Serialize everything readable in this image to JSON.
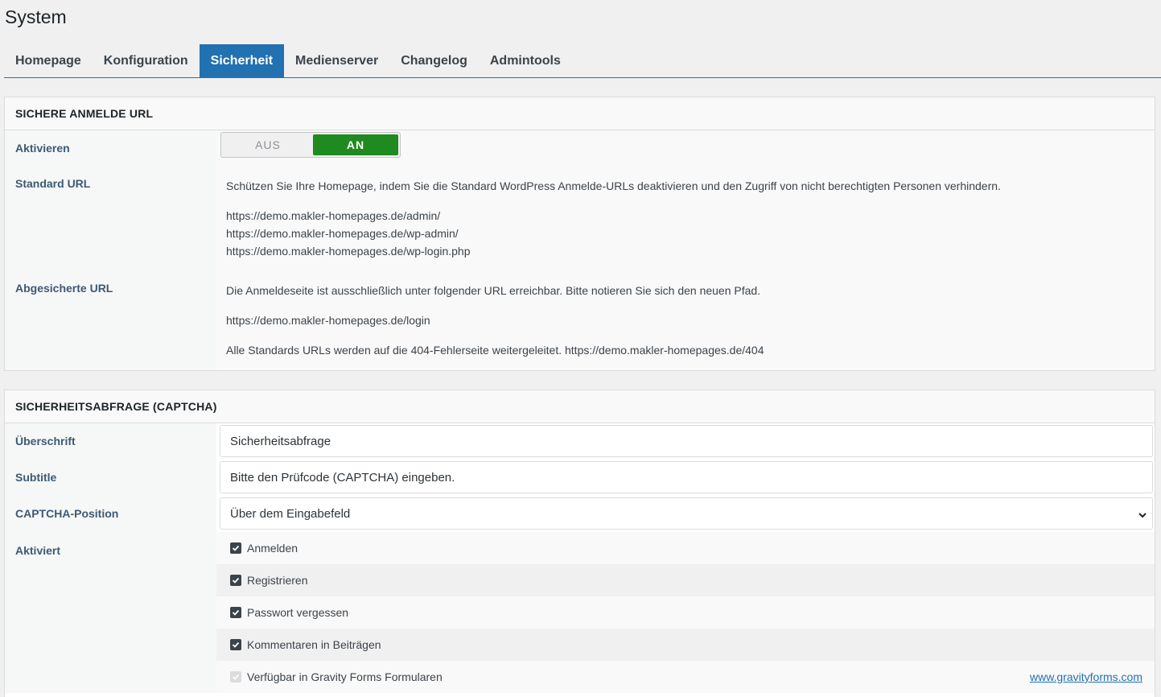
{
  "page": {
    "title": "System"
  },
  "tabs": [
    {
      "label": "Homepage",
      "active": false
    },
    {
      "label": "Konfiguration",
      "active": false
    },
    {
      "label": "Sicherheit",
      "active": true
    },
    {
      "label": "Medienserver",
      "active": false
    },
    {
      "label": "Changelog",
      "active": false
    },
    {
      "label": "Admintools",
      "active": false
    }
  ],
  "secure_login": {
    "header": "SICHERE ANMELDE URL",
    "activate": {
      "label": "Aktivieren",
      "off_label": "AUS",
      "on_label": "AN",
      "state": "on"
    },
    "standard_url": {
      "label": "Standard URL",
      "description": "Schützen Sie Ihre Homepage, indem Sie die Standard WordPress Anmelde-URLs deaktivieren und den Zugriff von nicht berechtigten Personen verhindern.",
      "urls": [
        "https://demo.makler-homepages.de/admin/",
        "https://demo.makler-homepages.de/wp-admin/",
        "https://demo.makler-homepages.de/wp-login.php"
      ]
    },
    "secured_url": {
      "label": "Abgesicherte URL",
      "description": "Die Anmeldeseite ist ausschließlich unter folgender URL erreichbar. Bitte notieren Sie sich den neuen Pfad.",
      "url": "https://demo.makler-homepages.de/login",
      "redirect_note": "Alle Standards URLs werden auf die 404-Fehlerseite weitergeleitet. https://demo.makler-homepages.de/404"
    }
  },
  "captcha": {
    "header": "SICHERHEITSABFRAGE (CAPTCHA)",
    "heading": {
      "label": "Überschrift",
      "value": "Sicherheitsabfrage"
    },
    "subtitle": {
      "label": "Subtitle",
      "value": "Bitte den Prüfcode (CAPTCHA) eingeben."
    },
    "position": {
      "label": "CAPTCHA-Position",
      "value": "Über dem Eingabefeld"
    },
    "enabled": {
      "label": "Aktiviert",
      "options": [
        {
          "label": "Anmelden",
          "checked": true,
          "disabled": false
        },
        {
          "label": "Registrieren",
          "checked": true,
          "disabled": false
        },
        {
          "label": "Passwort vergessen",
          "checked": true,
          "disabled": false
        },
        {
          "label": "Kommentaren in Beiträgen",
          "checked": true,
          "disabled": false
        },
        {
          "label": "Verfügbar in Gravity Forms Formularen",
          "checked": true,
          "disabled": true
        }
      ],
      "gravity_link": "www.gravityforms.com"
    }
  },
  "colors": {
    "accent": "#2271b1",
    "toggle_on": "#1f8a1f"
  },
  "icons": {
    "select_arrow": "chevron-down-icon",
    "checkbox": "checkmark-icon"
  }
}
